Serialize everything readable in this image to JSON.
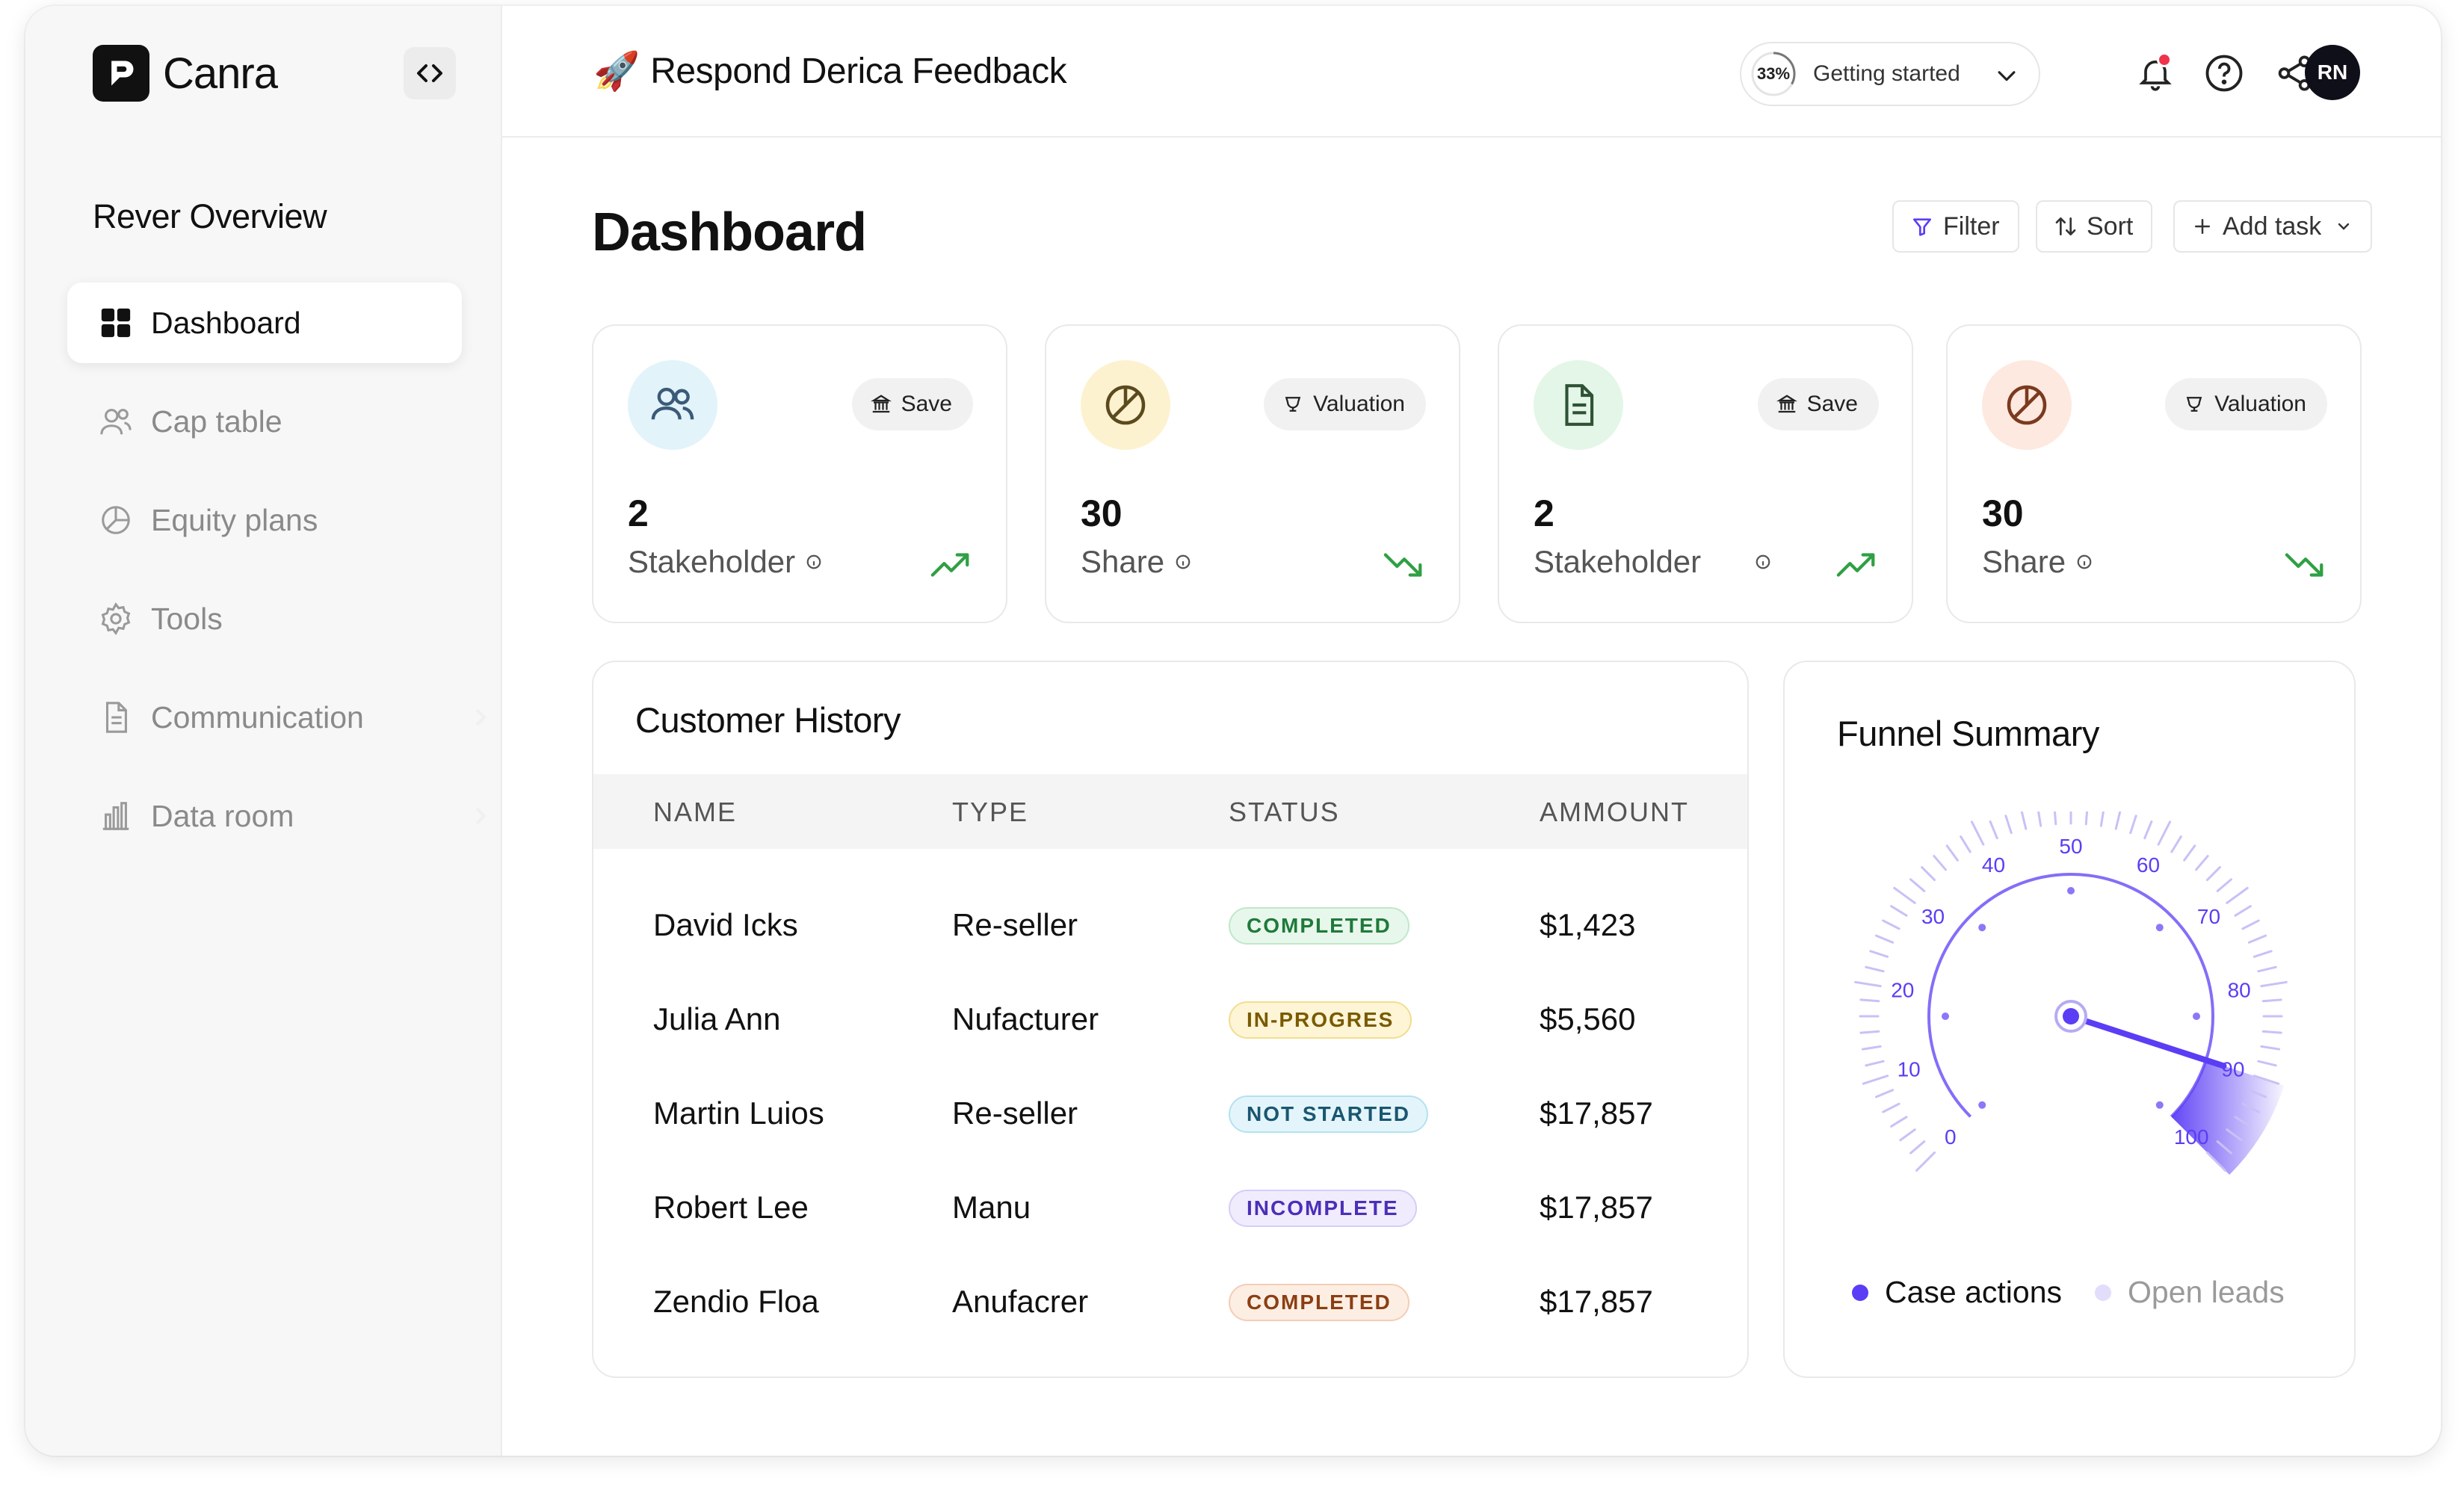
{
  "brand": {
    "name": "Canra"
  },
  "sidebar": {
    "header": "Rever Overview",
    "items": [
      {
        "label": "Dashboard",
        "icon": "grid-icon",
        "active": true
      },
      {
        "label": "Cap table",
        "icon": "users-icon"
      },
      {
        "label": "Equity plans",
        "icon": "pie-chart-icon"
      },
      {
        "label": "Tools",
        "icon": "gear-icon"
      },
      {
        "label": "Communication",
        "icon": "document-icon"
      },
      {
        "label": "Data room",
        "icon": "bar-chart-icon"
      }
    ]
  },
  "header": {
    "emoji": "🚀",
    "title": "Respond Derica Feedback",
    "progress_value": 0.33,
    "progress_text": "33%",
    "progress_label": "Getting started",
    "avatar_initials": "RN"
  },
  "dashboard": {
    "title": "Dashboard",
    "actions": {
      "filter": "Filter",
      "sort": "Sort",
      "add_task": "Add task"
    }
  },
  "stats": [
    {
      "value": "2",
      "label": "Stakeholder",
      "tag": "Save",
      "tag_icon": "bank-icon",
      "icon": "users-icon",
      "icon_bg": "#e2f3fa",
      "icon_color": "#3a5a78",
      "trend": "up"
    },
    {
      "value": "30",
      "label": "Share",
      "tag": "Valuation",
      "tag_icon": "trophy-icon",
      "icon": "pie-chart-icon",
      "icon_bg": "#fdf2cf",
      "icon_color": "#5b4a1e",
      "trend": "down"
    },
    {
      "value": "2",
      "label": "Stakeholder",
      "tag": "Save",
      "tag_icon": "bank-icon",
      "icon": "document-icon",
      "icon_bg": "#e3f6e7",
      "icon_color": "#2f5236",
      "trend": "up"
    },
    {
      "value": "30",
      "label": "Share",
      "tag": "Valuation",
      "tag_icon": "trophy-icon",
      "icon": "pie-chart-icon",
      "icon_bg": "#fde9df",
      "icon_color": "#7a3a1f",
      "trend": "down"
    }
  ],
  "history": {
    "title": "Customer History",
    "columns": [
      "NAME",
      "TYPE",
      "STATUS",
      "AMMOUNT"
    ],
    "rows": [
      {
        "name": "David Icks",
        "type": "Re-seller",
        "status": "COMPLETED",
        "status_style": "green",
        "amount": "$1,423"
      },
      {
        "name": "Julia Ann",
        "type": "Nufacturer",
        "status": "IN-PROGRES",
        "status_style": "yellow",
        "amount": "$5,560"
      },
      {
        "name": "Martin Luios",
        "type": "Re-seller",
        "status": "NOT STARTED",
        "status_style": "blue",
        "amount": "$17,857"
      },
      {
        "name": "Robert Lee",
        "type": "Manu",
        "status": "INCOMPLETE",
        "status_style": "purple",
        "amount": "$17,857"
      },
      {
        "name": "Zendio Floa",
        "type": "Anufacrer",
        "status": "COMPLETED",
        "status_style": "orange",
        "amount": "$17,857"
      }
    ]
  },
  "funnel": {
    "title": "Funnel Summary",
    "gauge_ticks": [
      "0",
      "10",
      "20",
      "30",
      "40",
      "50",
      "60",
      "70",
      "80",
      "90",
      "100"
    ],
    "gauge_value": 90,
    "legend": [
      {
        "label": "Case actions",
        "color": "#5b3df5"
      },
      {
        "label": "Open leads",
        "color": "#e2ddfb"
      }
    ]
  },
  "colors": {
    "accent": "#5b3df5",
    "trend_up": "#2fa043",
    "trend_down": "#2fa043",
    "notification": "#f0334b"
  }
}
